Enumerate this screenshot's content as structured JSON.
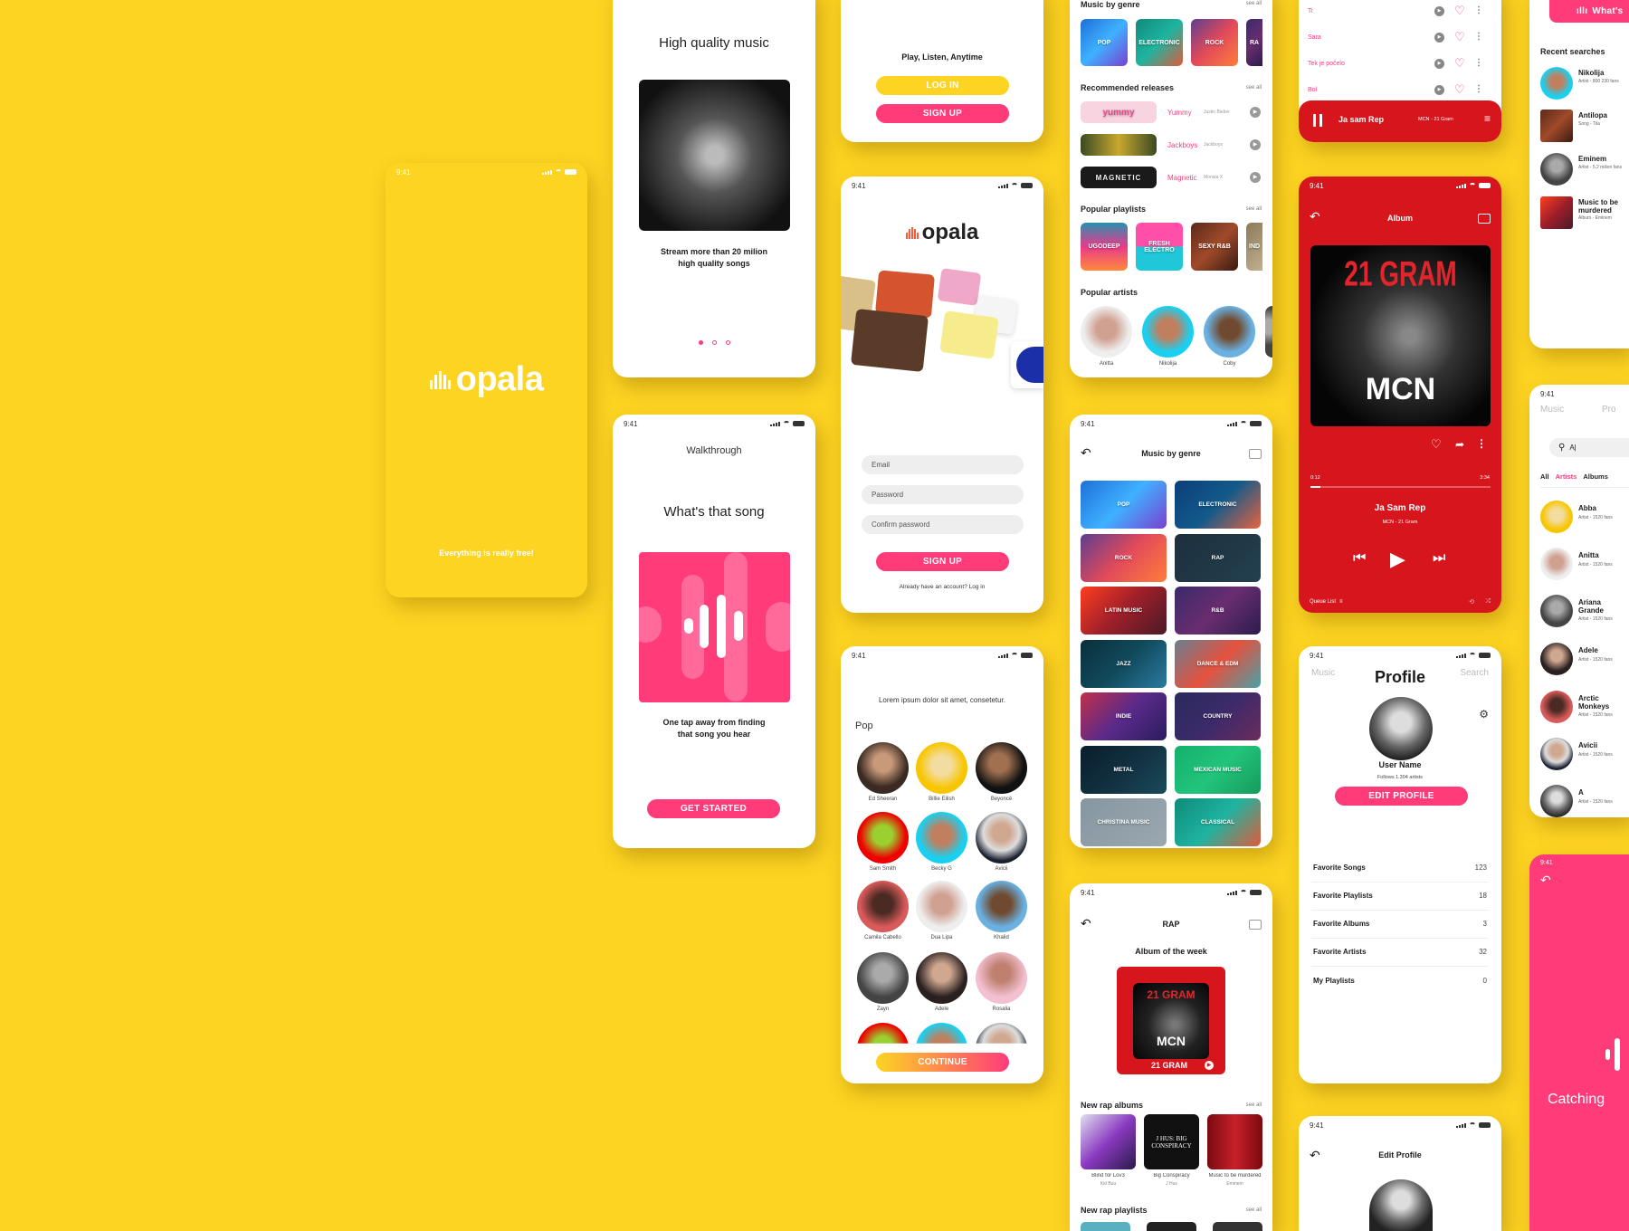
{
  "status_time": "9:41",
  "colors": {
    "background": "#FDD422",
    "pink": "#FF3B7A",
    "red": "#D6161C",
    "yellow": "#FDD422"
  },
  "splash": {
    "logo": "opala",
    "tagline": "Everything is really free!"
  },
  "onboarding": {
    "title": "High quality music",
    "caption_line1": "Stream more than 20 milion",
    "caption_line2": "high quality songs",
    "page_index": 1,
    "page_count": 3
  },
  "walkthrough": {
    "header": "Walkthrough",
    "title": "What's that song",
    "caption_line1": "One tap away from finding",
    "caption_line2": "that song you hear",
    "button": "GET STARTED"
  },
  "welcome": {
    "tagline": "Play, Listen, Anytime",
    "login": "LOG IN",
    "signup": "SIGN UP"
  },
  "signup": {
    "logo": "opala",
    "email_placeholder": "Email",
    "password_placeholder": "Password",
    "confirm_placeholder": "Confirm password",
    "button": "SIGN UP",
    "login_link": "Already have an account? Log in"
  },
  "pick_artists": {
    "intro": "Lorem ipsum dolor sit amet, consetetur.",
    "genre": "Pop",
    "artists": [
      "Ed Sheeran",
      "Billie Eilish",
      "Beyoncé",
      "Sam Smith",
      "Becky G",
      "Avicii",
      "Camila Cabello",
      "Dua Lipa",
      "Khalid",
      "Zayn",
      "Adele",
      "Rosalia"
    ],
    "button": "CONTINUE"
  },
  "home": {
    "genres_title": "Music by genre",
    "see_all": "see all",
    "genres": [
      "POP",
      "ELECTRONIC",
      "ROCK",
      "RA"
    ],
    "releases_title": "Recommended releases",
    "releases": [
      {
        "title": "Yummy",
        "artist": "Justin Bieber",
        "cover": "yummy"
      },
      {
        "title": "Jackboys",
        "artist": "Jackboys",
        "cover": ""
      },
      {
        "title": "Magnetic",
        "artist": "Monsta X",
        "cover": "MAGNETIC"
      }
    ],
    "playlists_title": "Popular playlists",
    "playlists": [
      "UGODEEP",
      "FRESH ELECTRO",
      "SEXY R&B",
      "IND"
    ],
    "artists_title": "Popular artists",
    "artists": [
      "Anitta",
      "Nikolija",
      "Coby"
    ]
  },
  "genre_screen": {
    "title": "Music by genre",
    "genres": [
      "POP",
      "ELECTRONIC",
      "ROCK",
      "RAP",
      "LATIN MUSIC",
      "R&B",
      "JAZZ",
      "DANCE & EDM",
      "INDIE",
      "COUNTRY",
      "METAL",
      "MEXICAN MUSIC",
      "CHRISTINA MUSIC",
      "CLASSICAL"
    ]
  },
  "rap": {
    "title": "RAP",
    "album_week_title": "Album of the week",
    "album_week": "21 GRAM",
    "cover_text": "21 GRAM",
    "cover_artist": "MCN",
    "new_albums_title": "New rap albums",
    "see_all": "see all",
    "albums": [
      {
        "title": "Blind for Lov3",
        "artist": "Kid Buu"
      },
      {
        "title": "Big Conspiracy",
        "artist": "J Hus",
        "cover": "J HUS: BIG CONSPIRACY"
      },
      {
        "title": "Music to be murdered",
        "artist": "Eminem"
      }
    ],
    "new_playlists_title": "New rap playlists"
  },
  "song_list": {
    "songs": [
      "Ti",
      "Sara",
      "Tek je počelo",
      "Bol"
    ],
    "mini_player": {
      "title": "Ja sam Rep",
      "subtitle": "MCN - 21 Gram"
    }
  },
  "player": {
    "title": "Album",
    "cover_text": "21 GRAM",
    "cover_artist": "MCN",
    "elapsed": "0:12",
    "duration": "3:34",
    "progress": 0.056,
    "track": "Ja Sam Rep",
    "subtitle": "MCN - 21 Gram",
    "queue": "Queue List"
  },
  "profile": {
    "tab_left": "Music",
    "title": "Profile",
    "tab_right": "Search",
    "user_name": "User Name",
    "follows": "Follows 1.304 artists",
    "edit_button": "EDIT PROFILE",
    "rows": [
      {
        "label": "Favorite Songs",
        "value": "123"
      },
      {
        "label": "Favorite Playlists",
        "value": "18"
      },
      {
        "label": "Favorite Albums",
        "value": "3"
      },
      {
        "label": "Favorite Artists",
        "value": "32"
      },
      {
        "label": "My Playlists",
        "value": "0"
      }
    ]
  },
  "edit_profile": {
    "title": "Edit Profile"
  },
  "recent": {
    "button": "What's",
    "title": "Recent searches",
    "items": [
      {
        "name": "Nikolija",
        "sub": "Artist - 800 230 fans"
      },
      {
        "name": "Antilopa",
        "sub": "Song - Tila"
      },
      {
        "name": "Eminem",
        "sub": "Artist - 5.2 milion fans"
      },
      {
        "name": "Music to be murdered",
        "sub": "Album - Eminem"
      }
    ]
  },
  "search": {
    "tab_left": "Music",
    "tab_right": "Pro",
    "query": "A|",
    "filters": [
      "All",
      "Artists",
      "Albums"
    ],
    "active_filter": "Artists",
    "results": [
      {
        "name": "Abba",
        "sub": "Artist - 1520 fans"
      },
      {
        "name": "Anitta",
        "sub": "Artist - 1520 fans"
      },
      {
        "name": "Ariana Grande",
        "sub": "Artist - 1520 fans"
      },
      {
        "name": "Adele",
        "sub": "Artist - 1520 fans"
      },
      {
        "name": "Arctic Monkeys",
        "sub": "Artist - 1520 fans"
      },
      {
        "name": "Avicii",
        "sub": "Artist - 1520 fans"
      },
      {
        "name": "A",
        "sub": "Artist - 1520 fans"
      }
    ]
  },
  "catching": {
    "text": "Catching"
  }
}
